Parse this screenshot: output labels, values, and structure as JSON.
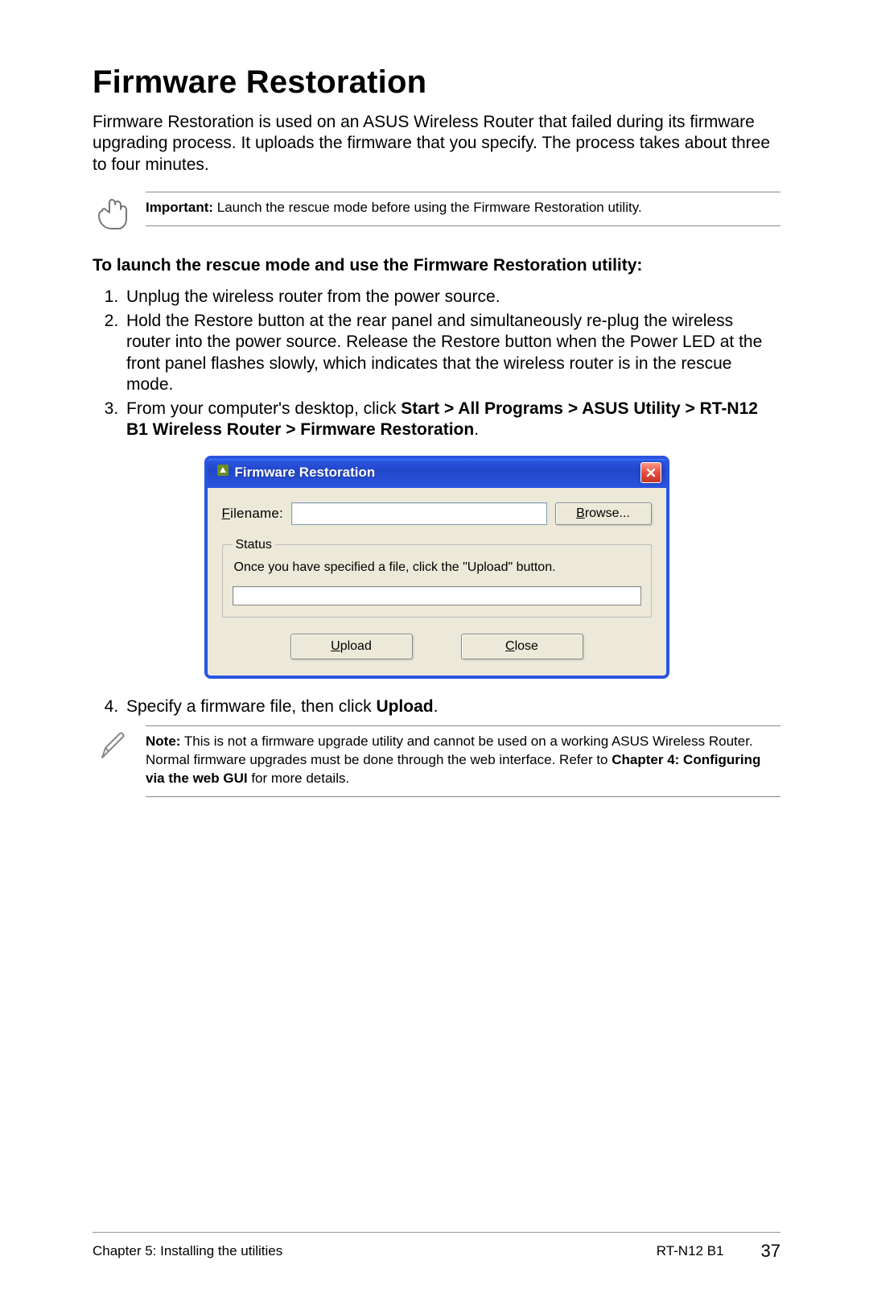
{
  "title": "Firmware Restoration",
  "intro": "Firmware Restoration is used on an ASUS Wireless Router that failed during its firmware upgrading process. It uploads the firmware that you specify. The process takes about three to four minutes.",
  "important": {
    "label": "Important:",
    "text": " Launch the rescue mode before using the Firmware Restoration utility."
  },
  "sub_heading": "To launch the rescue mode and use the Firmware Restoration utility:",
  "steps_a": [
    "Unplug the wireless router from the power source.",
    "Hold the Restore button at the rear panel and simultaneously re-plug the wireless router into the power source. Release the Restore button when the Power LED at the front panel flashes slowly, which indicates that the wireless router is in the rescue mode."
  ],
  "step3": {
    "pre": "From your computer's desktop, click ",
    "bold": "Start > All Programs > ASUS Utility > RT-N12 B1 Wireless Router > Firmware Restoration",
    "post": "."
  },
  "dialog": {
    "title": "Firmware Restoration",
    "filename_label": "Filename:",
    "browse": "Browse...",
    "status_legend": "Status",
    "status_text": "Once you have specified a file, click the \"Upload\" button.",
    "upload": "Upload",
    "close": "Close"
  },
  "step4": {
    "pre": "Specify a firmware file, then click ",
    "bold": "Upload",
    "post": "."
  },
  "note": {
    "label": "Note:",
    "text": " This is not a firmware upgrade utility and cannot be used on a working ASUS Wireless Router. Normal firmware upgrades must be done through the web interface. Refer to ",
    "bold": "Chapter 4: Configuring via the web GUI",
    "post": " for more details."
  },
  "footer": {
    "left": "Chapter 5: Installing the utilities",
    "model": "RT-N12 B1",
    "page": "37"
  }
}
